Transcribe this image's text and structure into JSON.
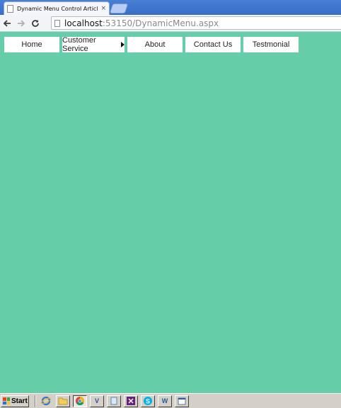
{
  "browser": {
    "tab_title": "Dynamic Menu Control Article",
    "tab_close": "×",
    "url_host": "localhost",
    "url_rest": ":53150/DynamicMenu.aspx"
  },
  "menu": {
    "items": [
      {
        "label": "Home",
        "has_submenu": false
      },
      {
        "label": "Customer Service",
        "has_submenu": true
      },
      {
        "label": "About",
        "has_submenu": false
      },
      {
        "label": "Contact Us",
        "has_submenu": false
      },
      {
        "label": "Testmonial",
        "has_submenu": false
      }
    ]
  },
  "colors": {
    "page_background": "#66cda9",
    "menu_background": "#ffffff"
  },
  "taskbar": {
    "start_label": "Start",
    "icons": [
      "ie-icon",
      "folder-icon",
      "chrome-icon",
      "visio-icon",
      "document-icon",
      "visual-studio-icon",
      "skype-icon",
      "word-icon",
      "window-icon"
    ]
  }
}
